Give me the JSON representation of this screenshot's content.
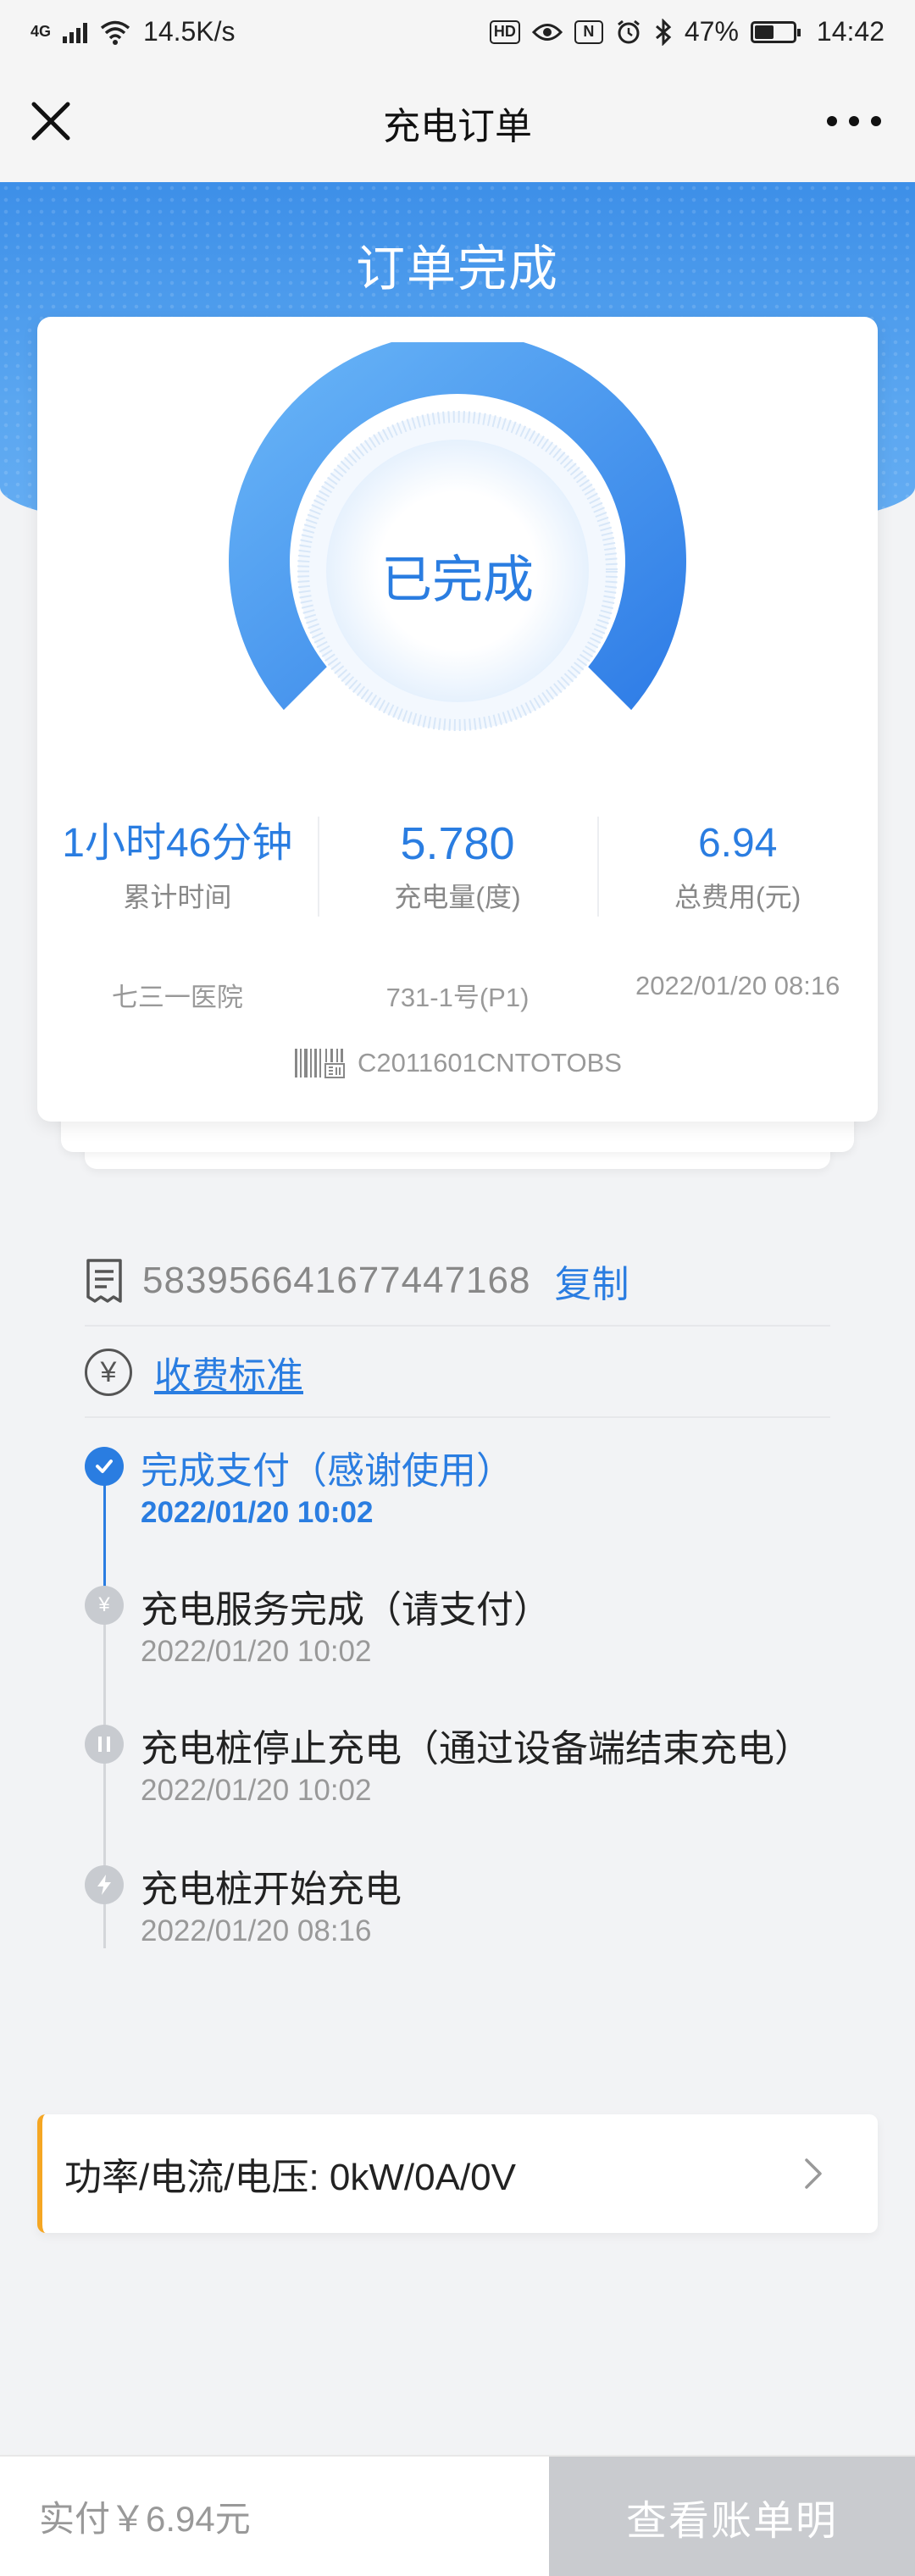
{
  "status_bar": {
    "network_type": "4G",
    "speed": "14.5K/s",
    "hd_badge": "HD",
    "nfc_badge": "N",
    "battery": "47%",
    "time": "14:42"
  },
  "header": {
    "title": "充电订单"
  },
  "banner": {
    "title": "订单完成"
  },
  "summary": {
    "status_label": "已完成",
    "stats": [
      {
        "value": "1小时46分钟",
        "label": "累计时间"
      },
      {
        "value": "5.780",
        "label": "充电量(度)"
      },
      {
        "value": "6.94",
        "label": "总费用(元)"
      }
    ],
    "station": "七三一医院",
    "pile": "731-1号(P1)",
    "datetime": "2022/01/20 08:16",
    "serial": "C2011601CNTOTOBS"
  },
  "order": {
    "number": "583956641677447168",
    "copy_label": "复制",
    "fee_link": "收费标准",
    "fee_icon": "¥"
  },
  "timeline": [
    {
      "title": "完成支付（感谢使用）",
      "time": "2022/01/20 10:02",
      "icon": "check-icon"
    },
    {
      "title": "充电服务完成（请支付）",
      "time": "2022/01/20 10:02",
      "icon": "yen-icon"
    },
    {
      "title": "充电桩停止充电（通过设备端结束充电）",
      "time": "2022/01/20 10:02",
      "icon": "pause-icon"
    },
    {
      "title": "充电桩开始充电",
      "time": "2022/01/20 08:16",
      "icon": "bolt-icon"
    }
  ],
  "power": {
    "text": "功率/电流/电压: 0kW/0A/0V"
  },
  "footer": {
    "paid_text": "实付￥6.94元",
    "bill_button": "查看账单明"
  },
  "colors": {
    "accent": "#2a7de1",
    "banner": "#4a9aec",
    "warning": "#f5a623",
    "disabled_button": "#c9cbcf"
  }
}
